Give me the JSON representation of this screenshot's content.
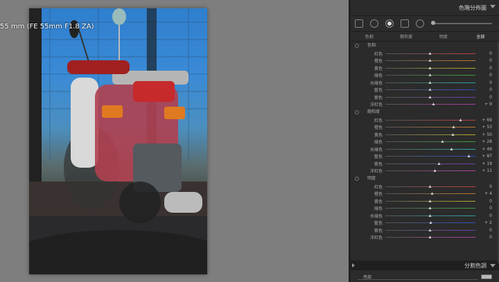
{
  "photo": {
    "lens_label": "55 mm (FE 55mm F1.8 ZA)"
  },
  "panel": {
    "title": "色階分佈圖",
    "tabs": [
      {
        "label": "色相",
        "active": false
      },
      {
        "label": "飽和度",
        "active": false
      },
      {
        "label": "明度",
        "active": false
      },
      {
        "label": "全部",
        "active": true
      }
    ],
    "groups": [
      {
        "title": "色相",
        "rows": [
          {
            "label": "紅色",
            "value": "0",
            "pos": 0.5,
            "color": "#c04040"
          },
          {
            "label": "橙色",
            "value": "0",
            "pos": 0.5,
            "color": "#c07a30"
          },
          {
            "label": "黃色",
            "value": "0",
            "pos": 0.5,
            "color": "#b8b030"
          },
          {
            "label": "綠色",
            "value": "0",
            "pos": 0.5,
            "color": "#3fa040"
          },
          {
            "label": "水綠色",
            "value": "0",
            "pos": 0.5,
            "color": "#30a8a8"
          },
          {
            "label": "藍色",
            "value": "0",
            "pos": 0.5,
            "color": "#3050c0"
          },
          {
            "label": "紫色",
            "value": "0",
            "pos": 0.5,
            "color": "#7040b0"
          },
          {
            "label": "洋紅色",
            "value": "+ 9",
            "pos": 0.54,
            "color": "#b040a0"
          }
        ]
      },
      {
        "title": "飽和度",
        "rows": [
          {
            "label": "紅色",
            "value": "+ 69",
            "pos": 0.84,
            "color": "#c04040"
          },
          {
            "label": "橙色",
            "value": "+ 53",
            "pos": 0.76,
            "color": "#c07a30"
          },
          {
            "label": "黃色",
            "value": "+ 50",
            "pos": 0.75,
            "color": "#b8b030"
          },
          {
            "label": "綠色",
            "value": "+ 28",
            "pos": 0.64,
            "color": "#3fa040"
          },
          {
            "label": "水綠色",
            "value": "+ 49",
            "pos": 0.74,
            "color": "#30a8a8"
          },
          {
            "label": "藍色",
            "value": "+ 87",
            "pos": 0.93,
            "color": "#3050c0"
          },
          {
            "label": "紫色",
            "value": "+ 19",
            "pos": 0.6,
            "color": "#7040b0"
          },
          {
            "label": "洋紅色",
            "value": "+ 11",
            "pos": 0.55,
            "color": "#b040a0"
          }
        ]
      },
      {
        "title": "明度",
        "rows": [
          {
            "label": "紅色",
            "value": "0",
            "pos": 0.5,
            "color": "#c04040"
          },
          {
            "label": "橙色",
            "value": "+ 4",
            "pos": 0.52,
            "color": "#c07a30"
          },
          {
            "label": "黃色",
            "value": "0",
            "pos": 0.5,
            "color": "#b8b030"
          },
          {
            "label": "綠色",
            "value": "0",
            "pos": 0.5,
            "color": "#3fa040"
          },
          {
            "label": "水綠色",
            "value": "0",
            "pos": 0.5,
            "color": "#30a8a8"
          },
          {
            "label": "藍色",
            "value": "+ 2",
            "pos": 0.51,
            "color": "#3050c0"
          },
          {
            "label": "紫色",
            "value": "0",
            "pos": 0.5,
            "color": "#7040b0"
          },
          {
            "label": "洋紅色",
            "value": "0",
            "pos": 0.5,
            "color": "#b040a0"
          }
        ]
      }
    ],
    "split_toning_title": "分割色調",
    "footer_label": "亮部"
  }
}
